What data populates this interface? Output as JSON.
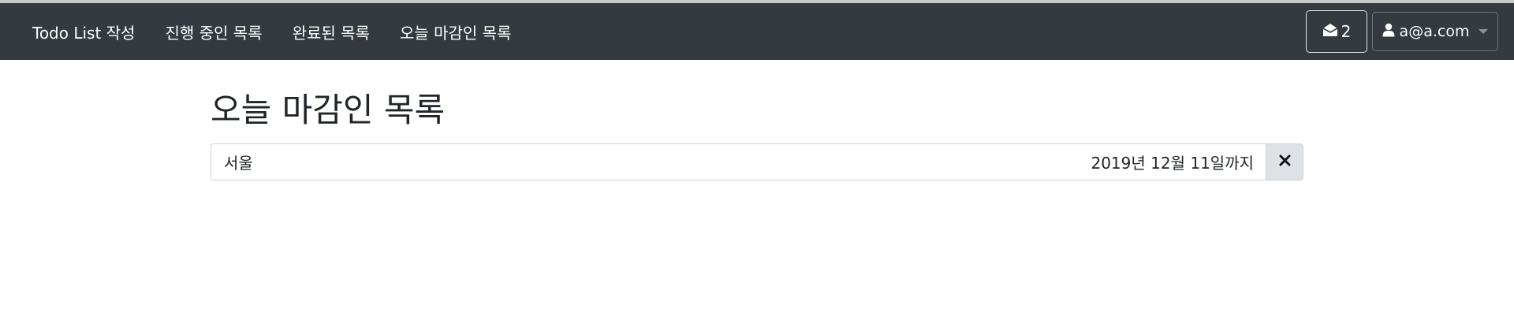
{
  "navbar": {
    "links": [
      {
        "label": "Todo List 작성"
      },
      {
        "label": "진행 중인 목록"
      },
      {
        "label": "완료된 목록"
      },
      {
        "label": "오늘 마감인 목록"
      }
    ],
    "messages": {
      "count": "2",
      "icon": "envelope-open-icon"
    },
    "user": {
      "email": "a@a.com",
      "icon": "user-icon"
    }
  },
  "main": {
    "title": "오늘 마감인 목록",
    "items": [
      {
        "name": "서울",
        "due": "2019년 12월 11일까지",
        "delete_icon": "close-icon"
      }
    ]
  },
  "colors": {
    "navbar_bg": "#343a40",
    "delete_button_bg": "#dee2e6"
  }
}
